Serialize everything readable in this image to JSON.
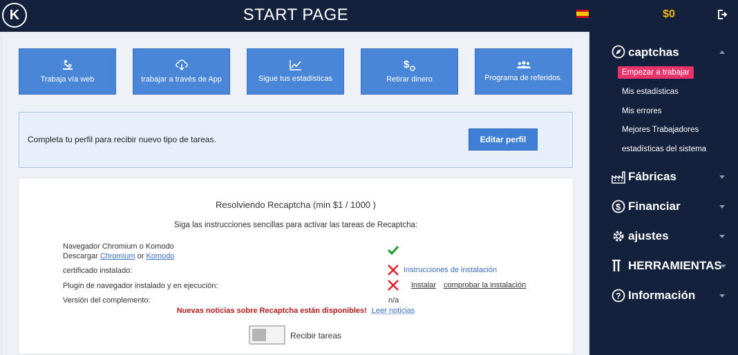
{
  "header": {
    "logo_letter": "K",
    "title": "START PAGE",
    "language_flag": "spain-flag-icon",
    "balance": "$0",
    "logout_icon": "logout-icon"
  },
  "actions": [
    {
      "label": "Trabaja vía web",
      "icon": "person-at-laptop-icon"
    },
    {
      "label": "trabajar a través de App",
      "icon": "cloud-download-icon"
    },
    {
      "label": "Sigue tus estadísticas",
      "icon": "stats-chart-icon"
    },
    {
      "label": "Retirar dinero",
      "icon": "dollar-withdraw-icon"
    },
    {
      "label": "Programa de referidos.",
      "icon": "users-group-icon"
    }
  ],
  "profile": {
    "message": "Completa tu perfil para recibir nuevo tipo de tareas.",
    "edit_button": "Editar perfil"
  },
  "recaptcha": {
    "title": "Resolviendo Recaptcha (min $1 / 1000 )",
    "instructions": "Siga las instrucciones sencillas para activar las tareas de Recaptcha:",
    "browser_label": "Navegador Chromium o Komodo",
    "download_label": "Descargar",
    "chromium_link": "Chromium",
    "or_word": "or",
    "komodo_link": "Komodo",
    "cert_label": "certificado instalado:",
    "cert_link": "Instrucciones de instalación",
    "plugin_label": "Plugin de navegador instalado y en ejecución:",
    "install_link": "Instalar",
    "check_link": "comprobar la instalación",
    "version_label": "Versión del complemento:",
    "version_value": "n/a",
    "news_text": "Nuevas noticias sobre Recaptcha están disponibles!",
    "news_link": "Leer noticias",
    "toggle_label": "Recibir tareas",
    "toggle_on": false,
    "colors": {
      "ok": "#1f9c2e",
      "error": "#e0202a",
      "news": "#b01c1c"
    }
  },
  "sidebar": {
    "sections": [
      {
        "label": "captchas",
        "icon": "compass-icon",
        "expanded": true
      },
      {
        "label": "Fábricas",
        "icon": "factory-icon",
        "expanded": false
      },
      {
        "label": "Financiar",
        "icon": "dollar-circle-icon",
        "expanded": false
      },
      {
        "label": "ajustes",
        "icon": "gear-icon",
        "expanded": false
      },
      {
        "label": "HERRAMIENTAS",
        "icon": "tools-icon",
        "expanded": false
      },
      {
        "label": "Información",
        "icon": "question-circle-icon",
        "expanded": false
      }
    ],
    "captcha_items": [
      {
        "label": "Empezar a trabajar",
        "active": true
      },
      {
        "label": "Mis estadísticas",
        "active": false
      },
      {
        "label": "Mis errores",
        "active": false
      },
      {
        "label": "Mejores Trabajadores",
        "active": false
      },
      {
        "label": "estadísticas del sistema",
        "active": false
      }
    ]
  },
  "colors": {
    "navy": "#14213d",
    "button_blue": "#4a86d8",
    "balance_gold": "#f2b705",
    "active_pink": "#e8336b"
  }
}
